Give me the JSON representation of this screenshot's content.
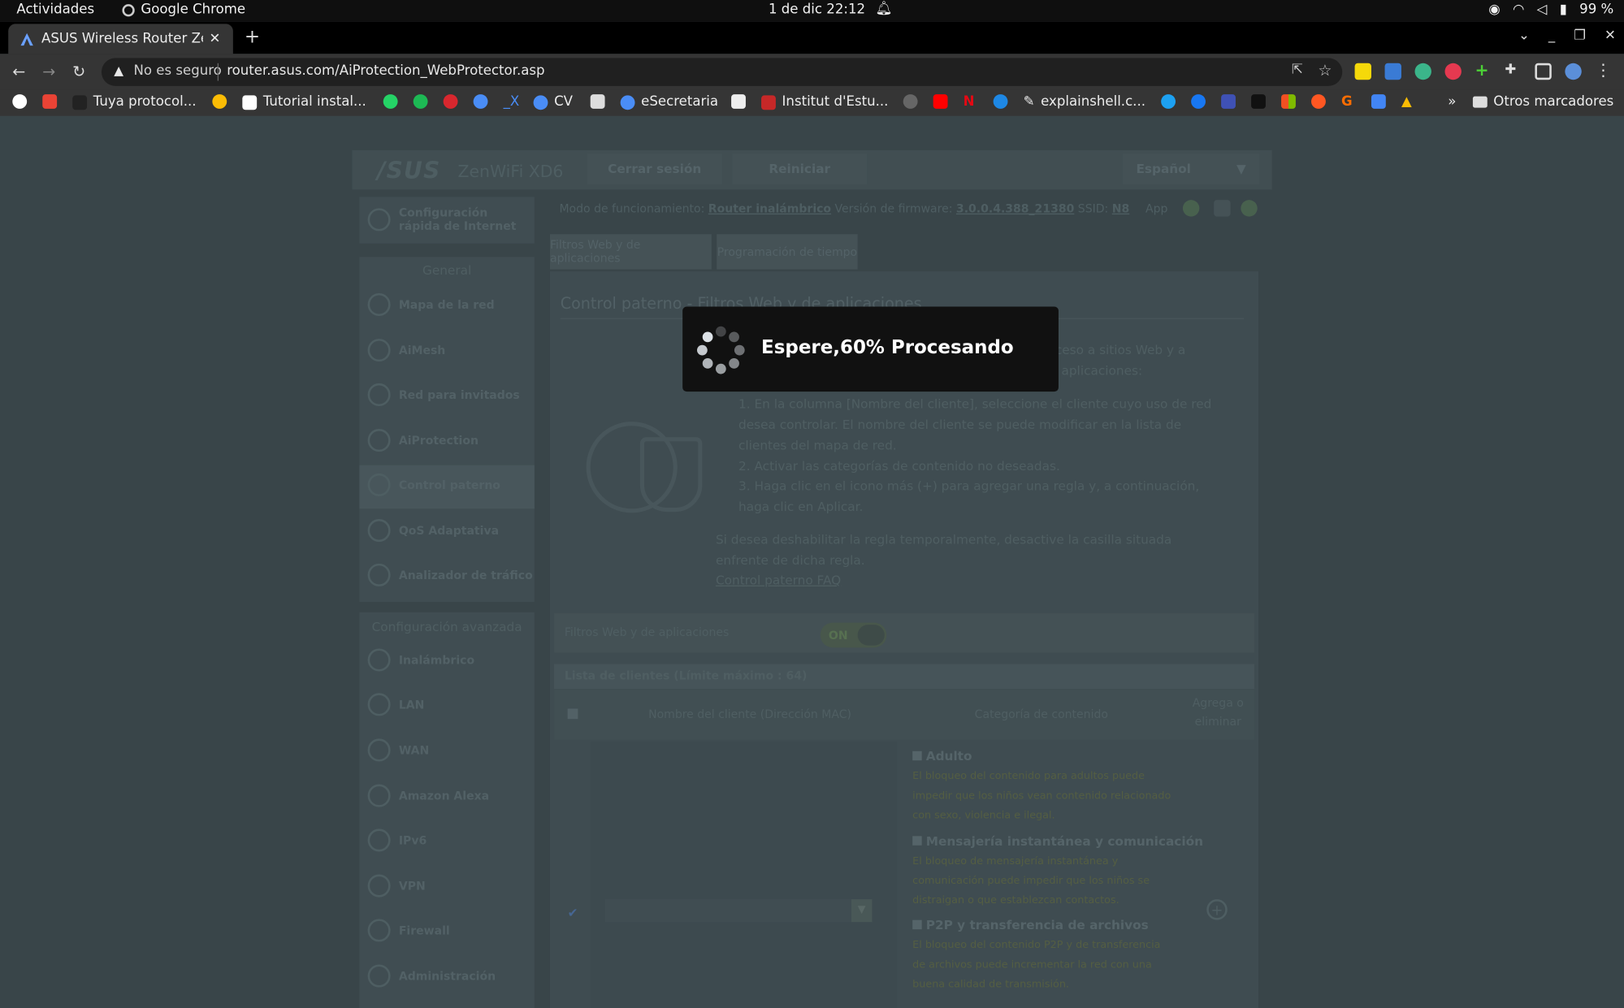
{
  "system_bar": {
    "activities": "Actividades",
    "app_name": "Google Chrome",
    "clock": "1 de dic  22:12",
    "battery": "99 %"
  },
  "browser": {
    "tab_title": "ASUS Wireless Router Zen",
    "address_warning": "No es seguro",
    "url": "router.asus.com/AiProtection_WebProtector.asp",
    "bookmarks": [
      {
        "label": "Tuya protocol..."
      },
      {
        "label": "Tutorial instal..."
      },
      {
        "label": "CV"
      },
      {
        "label": "eSecretaria"
      },
      {
        "label": "Institut d'Estu..."
      },
      {
        "label": "explainshell.c..."
      }
    ],
    "bookmarks_more": "»",
    "other_bookmarks": "Otros marcadores"
  },
  "router": {
    "logo": "/SUS",
    "model": "ZenWiFi XD6",
    "logout": "Cerrar sesión",
    "reboot": "Reiniciar",
    "language": "Español",
    "status": {
      "mode_label": "Modo de funcionamiento:",
      "mode_value": "Router inalámbrico",
      "fw_label": "Versión de firmware:",
      "fw_value": "3.0.0.4.388_21380",
      "ssid_label": "SSID:",
      "ssid_value": "N8",
      "app": "App"
    },
    "sidebar": {
      "quick_setup": "Configuración rápida de Internet",
      "general_header": "General",
      "general_items": [
        {
          "label": "Mapa de la red"
        },
        {
          "label": "AiMesh"
        },
        {
          "label": "Red para invitados"
        },
        {
          "label": "AiProtection"
        },
        {
          "label": "Control paterno"
        },
        {
          "label": "QoS Adaptativa"
        },
        {
          "label": "Analizador de tráfico"
        }
      ],
      "advanced_header": "Configuración avanzada",
      "advanced_items": [
        {
          "label": "Inalámbrico"
        },
        {
          "label": "LAN"
        },
        {
          "label": "WAN"
        },
        {
          "label": "Amazon Alexa"
        },
        {
          "label": "IPv6"
        },
        {
          "label": "VPN"
        },
        {
          "label": "Firewall"
        },
        {
          "label": "Administración"
        }
      ]
    },
    "tabs": [
      "Filtros Web y de aplicaciones",
      "Programación de tiempo"
    ],
    "content": {
      "title": "Control paterno - Filtros Web y de aplicaciones",
      "intro": "Filtros Web y de aplicaciones le permite bloquear el acceso a sitios Web y a aplicaciones no deseadas. Para utilizar filtros Web y de aplicaciones:",
      "steps": [
        "1.  En la columna [Nombre del cliente], seleccione el cliente cuyo uso de red desea controlar. El nombre del cliente se puede modificar en la lista de clientes del mapa de red.",
        "2.  Activar las categorías de contenido no deseadas.",
        "3.  Haga clic en el icono más (+) para agregar una regla y, a continuación, haga clic en Aplicar."
      ],
      "disable_note": "Si desea deshabilitar la regla temporalmente, desactive la casilla situada enfrente de dicha regla.",
      "faq": "Control paterno FAQ",
      "toggle_label": "Filtros Web y de aplicaciones",
      "toggle_value": "ON",
      "client_list": "Lista de clientes (Límite máximo : 64)",
      "col_client": "Nombre del cliente (Dirección MAC)",
      "col_category": "Categoría de contenido",
      "col_add": "Agrega o eliminar",
      "categories": [
        {
          "name": "Adulto",
          "desc": "El bloqueo del contenido para adultos puede impedir que los niños vean contenido relacionado con sexo, violencia e ilegal."
        },
        {
          "name": "Mensajería instantánea y comunicación",
          "desc": "El bloqueo de mensajería instantánea y comunicación puede impedir que los niños se distraigan o que establezcan contactos."
        },
        {
          "name": "P2P y transferencia de archivos",
          "desc": "El bloqueo del contenido P2P y de transferencia de archivos puede incrementar la red con una buena calidad de transmisión."
        }
      ]
    }
  },
  "modal": {
    "message": "Espere,60% Procesando",
    "progress_percent": 60
  }
}
